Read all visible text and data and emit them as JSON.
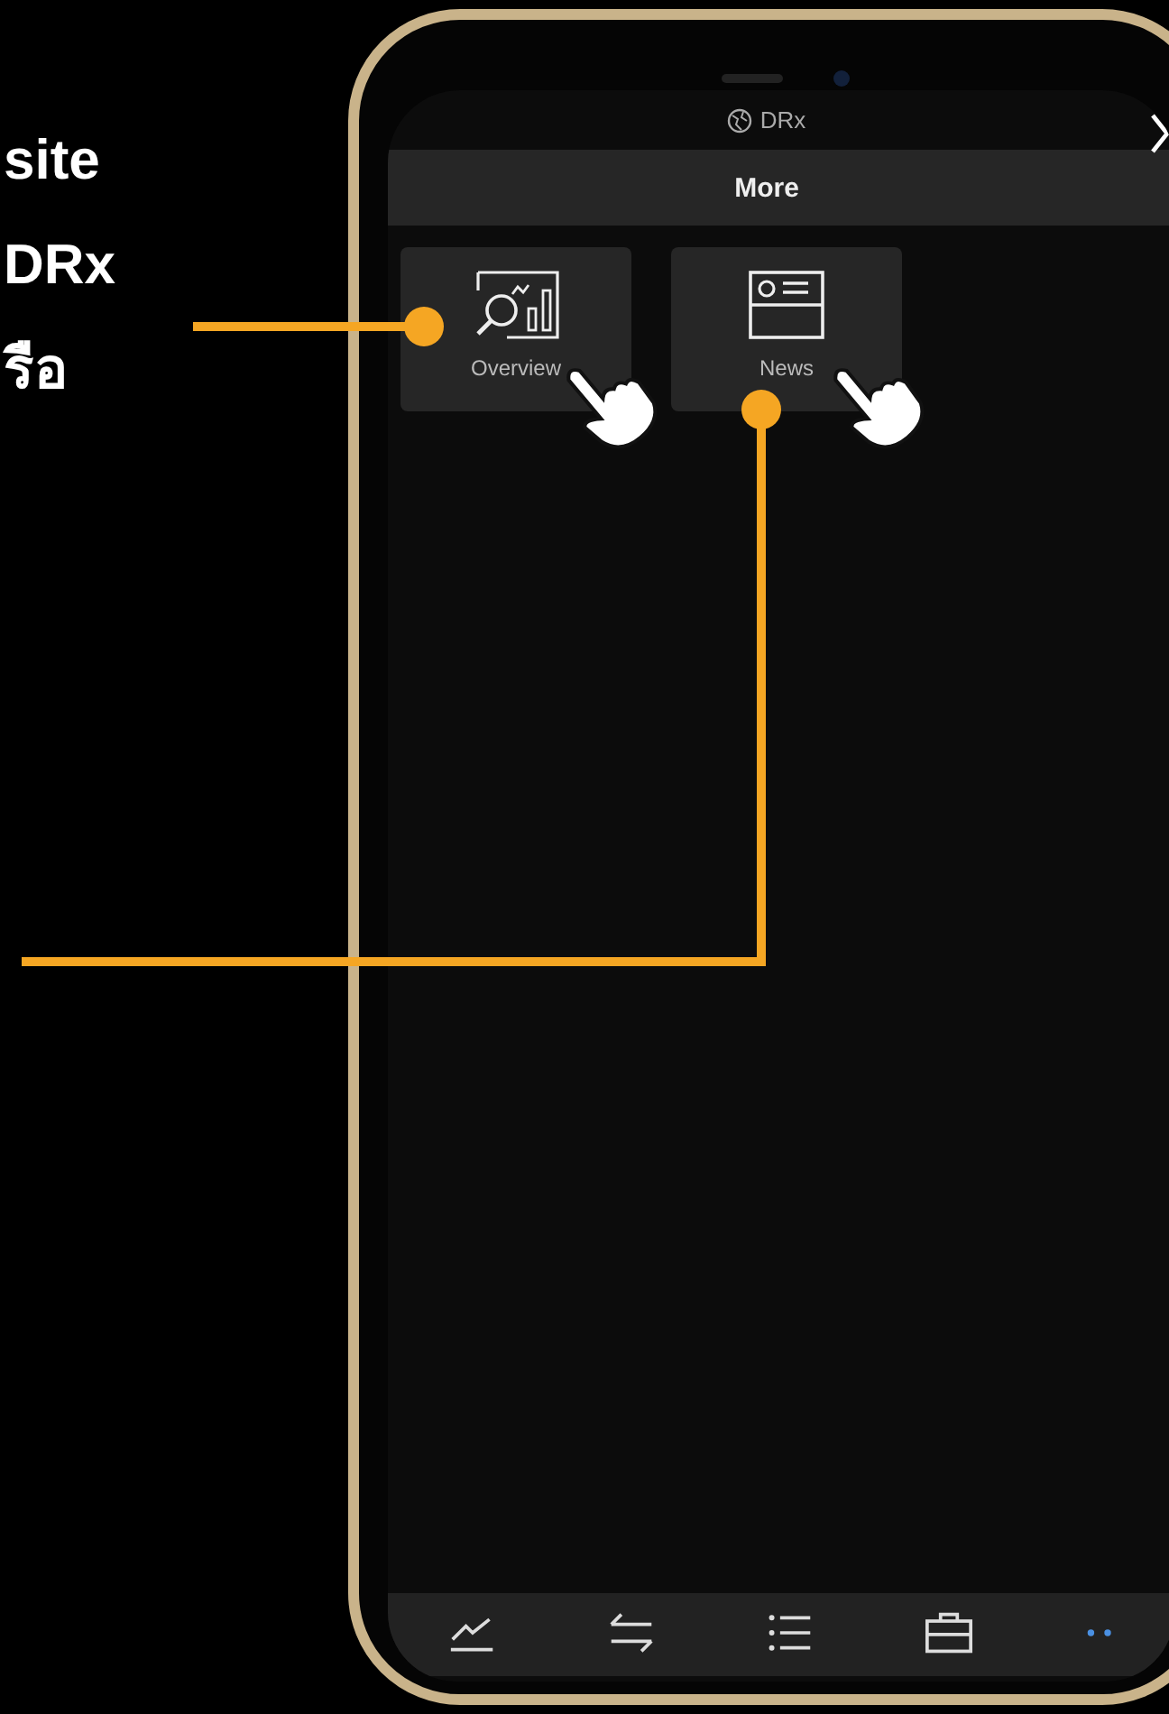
{
  "caption_lines": [
    "site",
    "DRx",
    "รือ"
  ],
  "app": {
    "title": "DRx",
    "header": "More"
  },
  "tiles": [
    {
      "label": "Overview"
    },
    {
      "label": "News"
    }
  ],
  "tab_bar": [
    {
      "selected": false
    },
    {
      "selected": false
    },
    {
      "selected": false
    },
    {
      "selected": false
    },
    {
      "selected": true
    }
  ]
}
